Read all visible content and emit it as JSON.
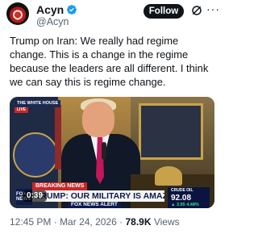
{
  "author": {
    "name": "Acyn",
    "handle": "@Acyn",
    "verified": true,
    "avatar": "avatar"
  },
  "actions": {
    "follow_label": "Follow",
    "grok_icon": "grok-icon",
    "more_icon": "more-icon"
  },
  "tweet": {
    "text": "Trump on Iran: We really had regime change. This is a change in the regime because the leaders are all different. I think we can say this is regime change."
  },
  "media": {
    "white_house_tag": "THE WHITE HOUSE",
    "live_tag": "LIVE",
    "breaking_label": "BREAKING NEWS",
    "headline": "TRUMP: OUR MILITARY IS AMAZING",
    "network_alert": "FOX NEWS ALERT",
    "network_logo": "FOX NEWS",
    "ticker": {
      "label": "CRUDE OIL",
      "value": "92.08",
      "change": "▲ 3.95 4.48%"
    },
    "duration": "0:39",
    "colors": {
      "breaking_red": "#c62828",
      "fox_navy": "#0d1b4d",
      "ticker_green": "#3ddc84"
    }
  },
  "footer": {
    "time": "12:45 PM",
    "separator": "·",
    "date": "Mar 24, 2026",
    "views_count": "78.9K",
    "views_label": "Views"
  }
}
